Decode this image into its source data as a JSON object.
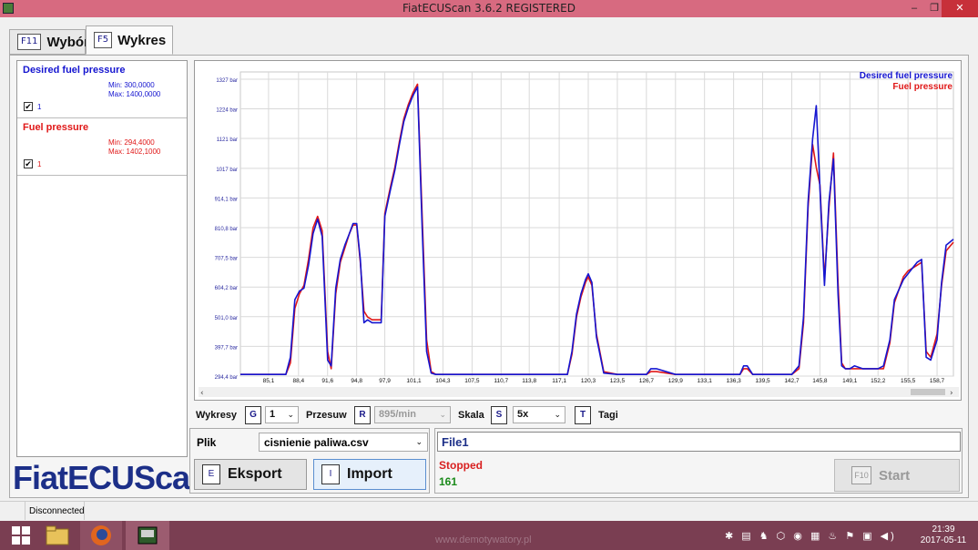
{
  "window": {
    "title": "FiatECUScan 3.6.2 REGISTERED",
    "minimize": "–",
    "maximize": "❐",
    "close": "✕"
  },
  "tabs": [
    {
      "key": "F11",
      "label": "Wybór"
    },
    {
      "key": "F5",
      "label": "Wykres"
    }
  ],
  "legend": [
    {
      "name": "Desired fuel pressure",
      "min": "Min: 300,0000",
      "max": "Max: 1400,0000",
      "checked": "✔",
      "check_label": "1",
      "color": "#1515d0"
    },
    {
      "name": "Fuel pressure",
      "min": "Min: 294,4000",
      "max": "Max: 1402,1000",
      "checked": "✔",
      "check_label": "1",
      "color": "#e01818"
    }
  ],
  "logo": "FiatECUScan",
  "chart_data": {
    "type": "line",
    "ytick_labels": [
      "1327 bar",
      "1224 bar",
      "1121 bar",
      "1017 bar",
      "914,1 bar",
      "810,8 bar",
      "707,5 bar",
      "604,2 bar",
      "501,0 bar",
      "397,7 bar",
      "294,4 bar"
    ],
    "yticks": [
      1327,
      1224,
      1121,
      1017,
      914.1,
      810.8,
      707.5,
      604.2,
      501.0,
      397.7,
      294.4
    ],
    "ylim": [
      294.4,
      1327
    ],
    "xtick_labels": [
      "85,1",
      "88,4",
      "91,6",
      "94,8",
      "97,9",
      "101,1",
      "104,3",
      "107,5",
      "110,7",
      "113,8",
      "117,1",
      "120,3",
      "123,5",
      "126,7",
      "129,9",
      "133,1",
      "136,3",
      "139,5",
      "142,7",
      "145,8",
      "149,1",
      "152,2",
      "155,5",
      "158,7"
    ],
    "xticks": [
      85.1,
      88.4,
      91.6,
      94.8,
      97.9,
      101.1,
      104.3,
      107.5,
      110.7,
      113.8,
      117.1,
      120.3,
      123.5,
      126.7,
      129.9,
      133.1,
      136.3,
      139.5,
      142.7,
      145.8,
      149.1,
      152.2,
      155.5,
      158.7
    ],
    "xlim": [
      82.0,
      160.5
    ],
    "grid": true,
    "legend_position": "top-right",
    "series": [
      {
        "name": "Desired fuel pressure",
        "color": "#1515d0",
        "x": [
          82.0,
          84.6,
          85.6,
          86.4,
          87.0,
          87.5,
          88.0,
          88.5,
          89.0,
          89.5,
          90.0,
          90.5,
          91.0,
          91.6,
          92.0,
          92.5,
          93.0,
          93.5,
          94.0,
          94.4,
          94.8,
          95.2,
          95.6,
          96.0,
          96.5,
          97.0,
          97.5,
          97.9,
          98.5,
          99.0,
          99.5,
          100.0,
          100.5,
          101.0,
          101.5,
          102.0,
          102.5,
          103.0,
          103.5,
          104.3,
          107.5,
          110.7,
          113.8,
          116.5,
          117.1,
          117.5,
          118.0,
          118.5,
          119.0,
          119.5,
          120.0,
          120.3,
          120.7,
          121.2,
          122.0,
          123.5,
          125.5,
          126.7,
          127.2,
          127.8,
          129.9,
          133.1,
          136.3,
          137.0,
          137.4,
          137.8,
          138.4,
          139.5,
          141.0,
          142.7,
          143.5,
          144.0,
          144.5,
          145.0,
          145.4,
          145.8,
          146.3,
          146.8,
          147.3,
          147.8,
          148.2,
          148.6,
          149.1,
          149.6,
          150.5,
          151.5,
          152.2,
          152.8,
          153.5,
          154.0,
          155.0,
          155.5,
          156.0,
          156.5,
          157.0,
          157.5,
          158.0,
          158.7,
          159.2,
          159.7,
          160.5
        ],
        "y": [
          300,
          300,
          300,
          300,
          300,
          360,
          560,
          590,
          600,
          680,
          790,
          840,
          780,
          350,
          330,
          600,
          700,
          750,
          790,
          825,
          825,
          700,
          480,
          490,
          480,
          480,
          480,
          850,
          940,
          1010,
          1100,
          1180,
          1230,
          1270,
          1300,
          820,
          380,
          305,
          300,
          300,
          300,
          300,
          300,
          300,
          300,
          300,
          300,
          380,
          510,
          580,
          630,
          650,
          620,
          430,
          305,
          300,
          300,
          300,
          320,
          320,
          300,
          300,
          300,
          300,
          330,
          330,
          300,
          300,
          300,
          300,
          330,
          500,
          900,
          1120,
          1235,
          950,
          610,
          900,
          1050,
          580,
          330,
          320,
          320,
          330,
          320,
          320,
          320,
          330,
          420,
          560,
          630,
          650,
          670,
          690,
          700,
          360,
          350,
          420,
          620,
          750,
          770
        ]
      },
      {
        "name": "Fuel pressure",
        "color": "#e01818",
        "x": [
          82.0,
          84.6,
          85.6,
          86.4,
          87.0,
          87.5,
          88.0,
          88.5,
          89.0,
          89.5,
          90.0,
          90.5,
          91.0,
          91.6,
          92.0,
          92.5,
          93.0,
          93.5,
          94.0,
          94.4,
          94.8,
          95.2,
          95.6,
          96.0,
          96.5,
          97.0,
          97.5,
          97.9,
          98.5,
          99.0,
          99.5,
          100.0,
          100.5,
          101.0,
          101.5,
          102.0,
          102.5,
          103.0,
          103.5,
          104.3,
          107.5,
          110.7,
          113.8,
          116.5,
          117.1,
          117.5,
          118.0,
          118.5,
          119.0,
          119.5,
          120.0,
          120.3,
          120.7,
          121.2,
          122.0,
          123.5,
          125.5,
          126.7,
          127.2,
          127.8,
          129.9,
          133.1,
          136.3,
          137.0,
          137.4,
          137.8,
          138.4,
          139.5,
          141.0,
          142.7,
          143.5,
          144.0,
          144.5,
          145.0,
          145.4,
          145.8,
          146.3,
          146.8,
          147.3,
          147.8,
          148.2,
          148.6,
          149.1,
          149.6,
          150.5,
          151.5,
          152.2,
          152.8,
          153.5,
          154.0,
          155.0,
          155.5,
          156.0,
          156.5,
          157.0,
          157.5,
          158.0,
          158.7,
          159.2,
          159.7,
          160.5
        ],
        "y": [
          300,
          300,
          300,
          300,
          300,
          340,
          530,
          580,
          610,
          700,
          810,
          850,
          800,
          380,
          320,
          580,
          690,
          740,
          790,
          820,
          820,
          690,
          520,
          500,
          490,
          490,
          490,
          860,
          950,
          1020,
          1110,
          1190,
          1240,
          1280,
          1310,
          860,
          420,
          310,
          300,
          300,
          300,
          300,
          300,
          300,
          300,
          300,
          300,
          370,
          500,
          570,
          620,
          640,
          610,
          440,
          310,
          300,
          300,
          300,
          310,
          310,
          300,
          300,
          300,
          300,
          320,
          320,
          300,
          300,
          300,
          300,
          320,
          480,
          880,
          1100,
          1020,
          960,
          630,
          880,
          1070,
          620,
          340,
          320,
          320,
          320,
          320,
          320,
          320,
          320,
          410,
          550,
          640,
          660,
          670,
          680,
          690,
          380,
          360,
          440,
          610,
          730,
          760
        ]
      }
    ]
  },
  "controls": {
    "wykresy_label": "Wykresy",
    "wykresy_key": "G",
    "wykresy_value": "1",
    "przesuw_label": "Przesuw",
    "przesuw_key": "R",
    "przesuw_value": "895/min",
    "skala_label": "Skala",
    "skala_key": "S",
    "skala_value": "5x",
    "tagi_key": "T",
    "tagi_label": "Tagi",
    "dropdown_arrow": "⌄"
  },
  "file": {
    "label": "Plik",
    "value": "cisnienie paliwa.csv",
    "eksport_key": "E",
    "eksport_label": "Eksport",
    "import_key": "I",
    "import_label": "Import"
  },
  "status": {
    "file_name": "File1",
    "state": "Stopped",
    "count": "161",
    "start_key": "F10",
    "start_label": "Start"
  },
  "statusbar": {
    "connection": "Disconnected"
  },
  "taskbar": {
    "watermark": "www.demotywatory.pl",
    "time": "21:39",
    "date": "2017-05-11",
    "tray_icons": "✱ ▤ ♞ ⬡ ◉ ▦ ♨ ⚑ ▣ ◀)"
  },
  "colors": {
    "titlebar": "#d76a80",
    "taskbar": "#7a3e52",
    "logo": "#1c2f88",
    "stopped": "#d82020",
    "count": "#1a8a1a"
  }
}
